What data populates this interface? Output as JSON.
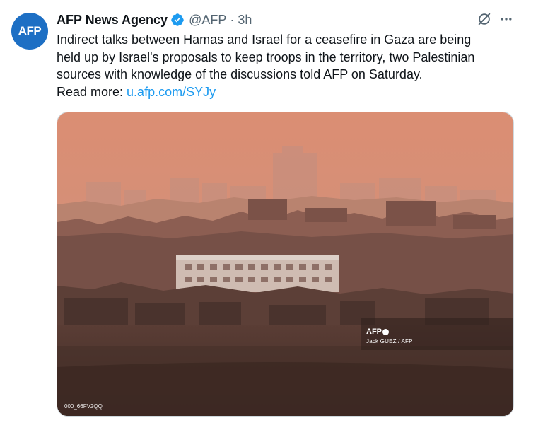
{
  "author": {
    "avatar_text": "AFP",
    "name": "AFP News Agency",
    "handle": "@AFP",
    "separator": "·",
    "time": "3h",
    "verified_icon": "verified-badge-icon"
  },
  "actions": {
    "grok_icon": "grok-icon",
    "more_icon": "more-icon"
  },
  "tweet": {
    "line1": "Indirect talks between Hamas and Israel for a ceasefire in Gaza are being",
    "line2": "held up by Israel's proposals to keep troops in the territory, two Palestinian",
    "line3": "sources with knowledge of the discussions told AFP on Saturday.",
    "readmore_label": "Read more: ",
    "link_text": "u.afp.com/SYJy"
  },
  "media": {
    "watermark_logo": "AFP",
    "watermark_credit": "Jack GUEZ / AFP",
    "image_id": "000_66FV2QQ"
  },
  "colors": {
    "link": "#1d9bf0",
    "verified": "#1d9bf0",
    "avatar": "#1d6fc4",
    "secondary_text": "#536471"
  }
}
